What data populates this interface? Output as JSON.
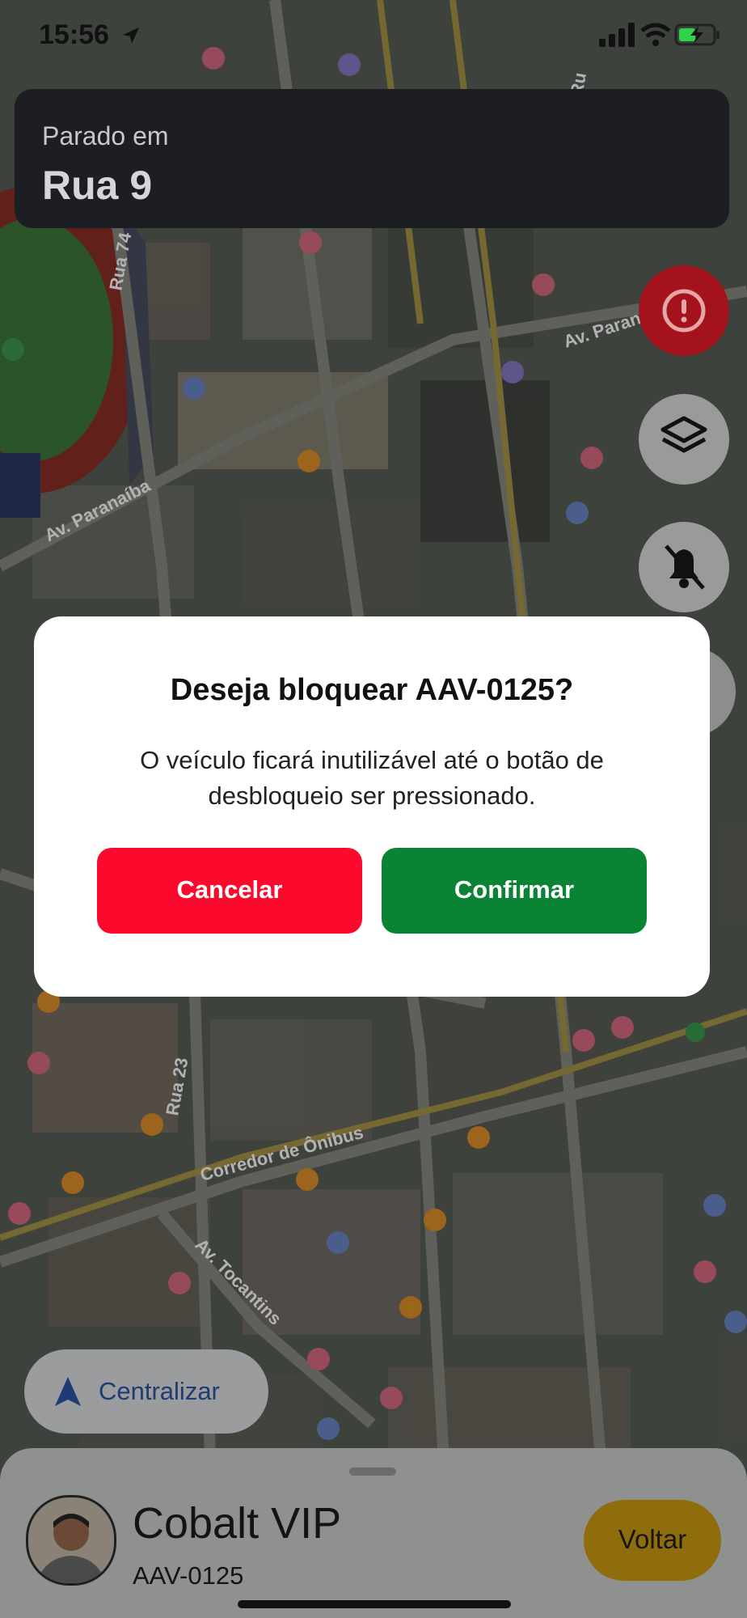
{
  "status_bar": {
    "time": "15:56"
  },
  "location_card": {
    "label": "Parado em",
    "street": "Rua 9"
  },
  "map": {
    "street_labels": [
      "Av. Paranaíba",
      "Rua 74",
      "Av. Paranaíba",
      "Rua 23",
      "Corredor de Ônibus",
      "Av. Tocantins",
      "Ru"
    ]
  },
  "fabs": {
    "alert_icon": "exclamation-circle-icon",
    "layers_icon": "layers-icon",
    "bell_icon": "bell-slash-icon"
  },
  "center_button": {
    "label": "Centralizar",
    "icon": "navigation-arrow-icon"
  },
  "bottom_sheet": {
    "vehicle_name": "Cobalt VIP",
    "plate": "AAV-0125",
    "back_label": "Voltar"
  },
  "dialog": {
    "title": "Deseja bloquear AAV-0125?",
    "message": "O veículo ficará inutilizável até o botão de desbloqueio ser pressionado.",
    "cancel_label": "Cancelar",
    "confirm_label": "Confirmar"
  },
  "colors": {
    "cancel": "#fb0a2d",
    "confirm": "#0b8335",
    "alert_fab": "#a3121d",
    "back_button": "#8f6c0c"
  }
}
